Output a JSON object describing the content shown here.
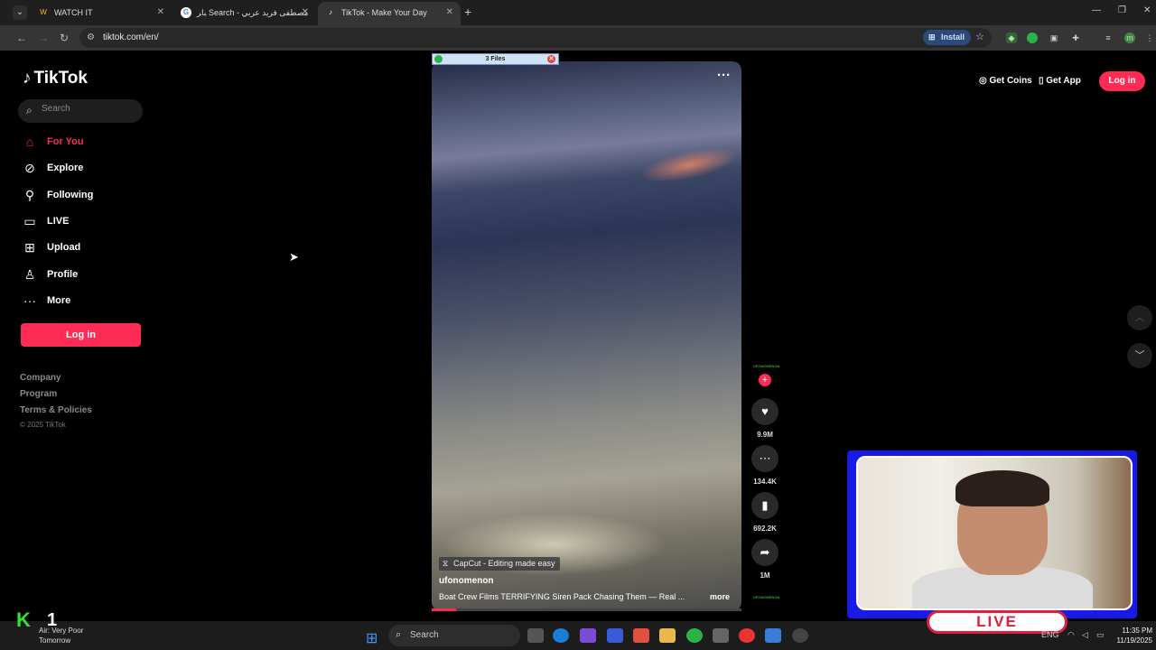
{
  "browser": {
    "tabs": [
      {
        "title": "WATCH IT",
        "favicon": "W"
      },
      {
        "title": "ﺒﺎﺮ Search - مصطفى فريد عربي",
        "favicon": "G"
      },
      {
        "title": "TikTok - Make Your Day",
        "favicon": "♪"
      }
    ],
    "url": "tiktok.com/en/",
    "install_label": "Install"
  },
  "sidebar": {
    "logo_text": "TikTok",
    "search_placeholder": "Search",
    "nav": [
      {
        "label": "For You",
        "icon": "home-icon"
      },
      {
        "label": "Explore",
        "icon": "compass-icon"
      },
      {
        "label": "Following",
        "icon": "following-icon"
      },
      {
        "label": "LIVE",
        "icon": "live-icon"
      },
      {
        "label": "Upload",
        "icon": "upload-icon"
      },
      {
        "label": "Profile",
        "icon": "profile-icon"
      },
      {
        "label": "More",
        "icon": "more-icon"
      }
    ],
    "login_label": "Log in",
    "footer_links": [
      "Company",
      "Program",
      "Terms & Policies"
    ],
    "copyright": "© 2025 TikTok"
  },
  "video": {
    "files_label": "3 Files",
    "capcut_label": "CapCut - Editing made easy",
    "author": "ufonomenon",
    "caption": "Boat Crew Films TERRIFYING Siren Pack Chasing Them — Real ...",
    "more_label": "more",
    "avatar_text": "UFONOMENON",
    "progress": 0.08
  },
  "actions": {
    "likes": "9.9M",
    "comments": "134.4K",
    "saves": "692.2K",
    "shares": "1M"
  },
  "header": {
    "get_coins": "Get Coins",
    "get_app": "Get App",
    "login_label": "Log in"
  },
  "overlay": {
    "live_label": "LIVE",
    "channel_mark": "K",
    "channel_num": "1"
  },
  "taskbar": {
    "weather_line1": "Air: Very Poor",
    "weather_line2": "Tomorrow",
    "search_label": "Search",
    "time": "11:35 PM",
    "date": "11/19/2025",
    "lang": "ENG"
  },
  "colors": {
    "accent": "#fe2c55",
    "background": "#000000"
  }
}
